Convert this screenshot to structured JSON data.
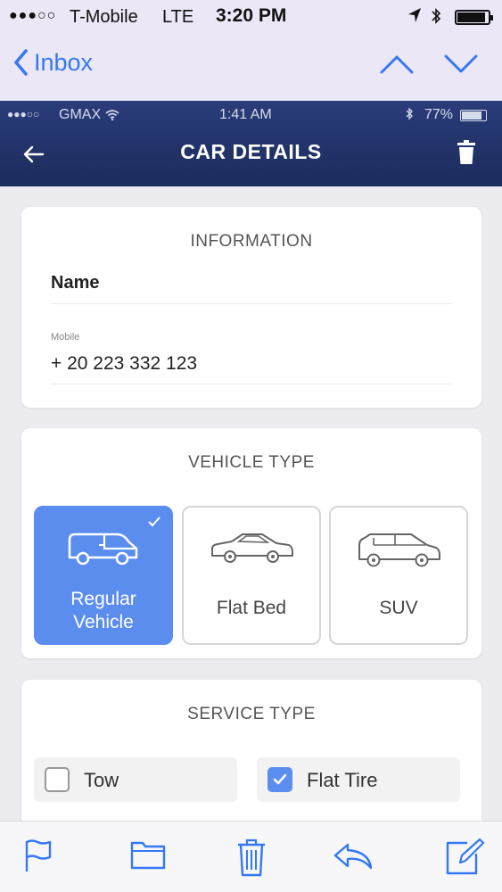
{
  "outer_status": {
    "signal_dots": "●●●○○",
    "carrier": "T-Mobile",
    "network": "LTE",
    "time": "3:20 PM",
    "battery_level": 0.85
  },
  "mail_nav": {
    "back_label": "Inbox"
  },
  "app_status": {
    "signal_dots": "●●●○○",
    "carrier": "GMAX",
    "time": "1:41 AM",
    "battery_percent": "77%",
    "battery_level": 0.77
  },
  "app_header": {
    "title": "CAR DETAILS"
  },
  "information": {
    "title": "INFORMATION",
    "name_placeholder": "Name",
    "mobile_label": "Mobile",
    "mobile_value": "+ 20 223 332 123"
  },
  "vehicle_type": {
    "title": "VEHICLE TYPE",
    "options": [
      {
        "line1": "Regular",
        "line2": "Vehicle",
        "icon": "van-icon",
        "selected": true
      },
      {
        "line1": "Flat Bed",
        "line2": "",
        "icon": "car-icon",
        "selected": false
      },
      {
        "line1": "SUV",
        "line2": "",
        "icon": "suv-icon",
        "selected": false
      }
    ]
  },
  "service_type": {
    "title": "SERVICE TYPE",
    "options": [
      {
        "label": "Tow",
        "checked": false
      },
      {
        "label": "Flat Tire",
        "checked": true
      }
    ]
  },
  "toolbar": {
    "icons": [
      "flag-icon",
      "folder-icon",
      "trash-icon",
      "reply-icon",
      "compose-icon"
    ]
  },
  "colors": {
    "accent": "#5b8def",
    "ios_blue": "#3478f6",
    "header_bg": "#1c2b5c"
  }
}
